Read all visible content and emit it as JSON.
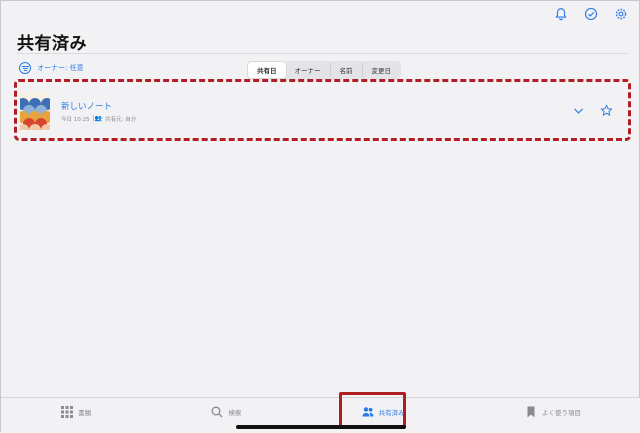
{
  "header": {
    "title": "共有済み",
    "icons": [
      "bell-icon",
      "checkmark-circle-icon",
      "gear-icon"
    ]
  },
  "filter": {
    "owner_label": "オーナー: 任意"
  },
  "sort": {
    "options": [
      "共有日",
      "オーナー",
      "名前",
      "変更日"
    ],
    "selected": "共有日"
  },
  "notes": [
    {
      "title": "新しいノート",
      "date": "今日 10:25",
      "shared_with": "共有元: 自分"
    }
  ],
  "tabbar": {
    "items": [
      {
        "label": "書類",
        "icon": "grid-icon"
      },
      {
        "label": "検索",
        "icon": "search-icon"
      },
      {
        "label": "共有済み",
        "icon": "people-icon"
      },
      {
        "label": "よく使う項目",
        "icon": "bookmark-icon"
      }
    ],
    "active": "共有済み"
  },
  "colors": {
    "accent": "#2c7be5",
    "highlight": "#b01e23",
    "background": "#f2f2f4"
  }
}
